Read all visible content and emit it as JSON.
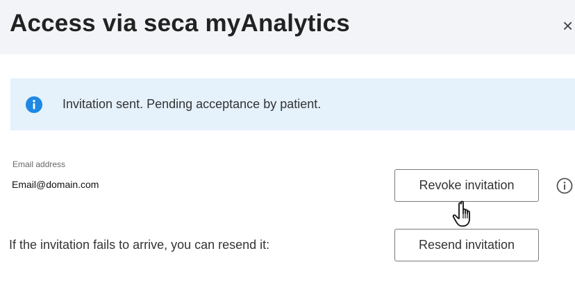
{
  "dialog": {
    "title": "Access via seca myAnalytics",
    "close_label": "×",
    "close_icon": "close-icon"
  },
  "banner": {
    "icon": "info-icon",
    "icon_color": "#1e88e5",
    "background": "#e5f1fb",
    "message": "Invitation sent. Pending acceptance by patient."
  },
  "email": {
    "label": "Email address",
    "value": "Email@domain.com"
  },
  "actions": {
    "revoke_label": "Revoke invitation",
    "resend_prompt": "If the invitation fails to arrive, you can resend it:",
    "resend_label": "Resend invitation",
    "help_icon": "help-info-icon"
  },
  "cursor": {
    "icon": "hand-pointer-cursor"
  }
}
